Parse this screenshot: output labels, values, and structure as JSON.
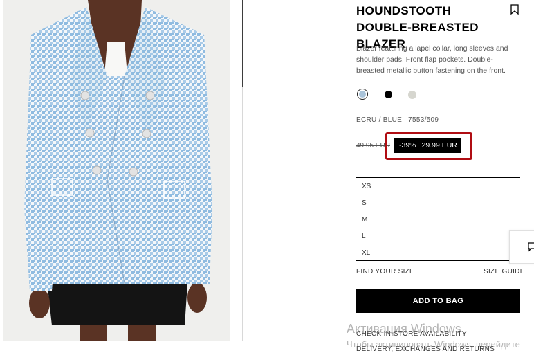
{
  "product": {
    "title": "HOUNDSTOOTH DOUBLE-BREASTED BLAZER",
    "description": "Blazer featuring a lapel collar, long sleeves and shoulder pads. Front flap pockets. Double-breasted metallic button fastening on the front.",
    "color_ref": "ECRU / BLUE | 7553/509",
    "swatches": [
      {
        "name": "ecru-blue",
        "color": "#a9c3d9",
        "selected": true
      },
      {
        "name": "black",
        "color": "#000000",
        "selected": false
      },
      {
        "name": "ecru",
        "color": "#d6d6cf",
        "selected": false
      }
    ],
    "old_price": "49.95 EUR",
    "discount": "-39%",
    "sale_price": "29.99 EUR",
    "sizes": [
      "XS",
      "S",
      "M",
      "L",
      "XL"
    ]
  },
  "actions": {
    "find_size": "FIND YOUR SIZE",
    "size_guide": "SIZE GUIDE",
    "add_to_bag": "ADD TO BAG",
    "store_availability": "CHECK IN-STORE AVAILABILITY",
    "delivery": "DELIVERY, EXCHANGES AND RETURNS"
  },
  "watermark": {
    "line1": "Активация Windows",
    "line2": "Чтобы активировать Windows, перейдите"
  },
  "colors": {
    "highlight_border": "#b00d13",
    "blazer_blue": "#8fbbe0",
    "skirt": "#141414"
  }
}
